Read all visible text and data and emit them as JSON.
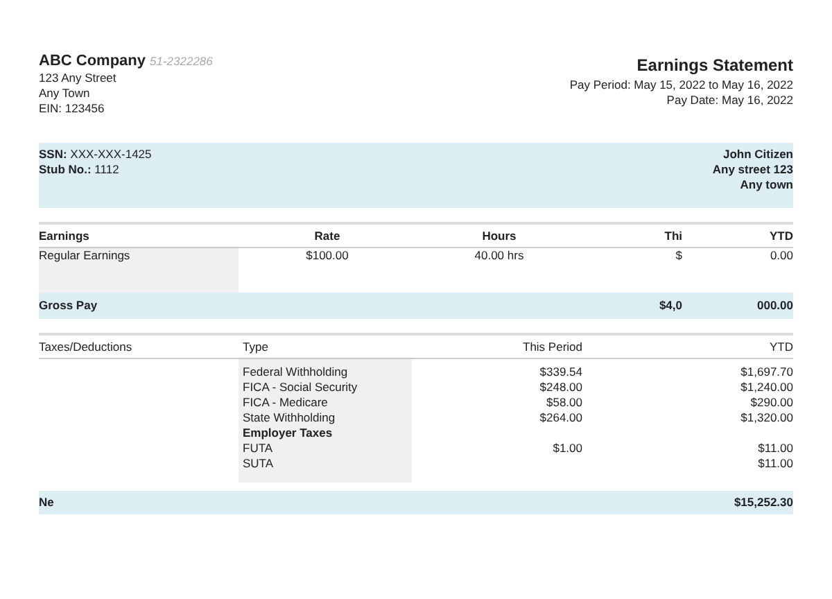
{
  "company": {
    "name": "ABC Company",
    "ein_code": "51-2322286",
    "lines": [
      "123 Any Street",
      "Any Town",
      "EIN: 123456"
    ]
  },
  "statement": {
    "title": "Earnings Statement",
    "pay_period": "Pay Period: May 15, 2022 to May 16, 2022",
    "pay_date": "Pay Date: May 16, 2022"
  },
  "employee": {
    "ssn_label": "SSN:",
    "ssn": "XXX-XXX-1425",
    "stub_label": "Stub No.:",
    "stub": "1112",
    "name": "John Citizen",
    "address": [
      "Any street 123",
      "Any town"
    ]
  },
  "earnings": {
    "columns": [
      "Earnings",
      "Rate",
      "Hours",
      "Thi",
      "YTD"
    ],
    "rows": [
      {
        "cells": [
          "Regular Earnings",
          "$100.00",
          "40.00 hrs",
          "$",
          "0.00"
        ]
      }
    ],
    "total": {
      "label": "Gross Pay",
      "this_period": "$4,0",
      "ytd": "000.00"
    }
  },
  "deductions": {
    "columns": [
      "Taxes/Deductions",
      "Type",
      "This Period",
      "YTD"
    ],
    "rows": [
      {
        "kind": "item",
        "type": "Federal Withholding",
        "this_period": "$339.54",
        "ytd": "$1,697.70"
      },
      {
        "kind": "item",
        "type": "FICA - Social Security",
        "this_period": "$248.00",
        "ytd": "$1,240.00"
      },
      {
        "kind": "item",
        "type": "FICA - Medicare",
        "this_period": "$58.00",
        "ytd": "$290.00"
      },
      {
        "kind": "item",
        "type": "State Withholding",
        "this_period": "$264.00",
        "ytd": "$1,320.00"
      },
      {
        "kind": "heading",
        "type": "Employer Taxes"
      },
      {
        "kind": "item",
        "type": "FUTA",
        "this_period": "$1.00",
        "ytd": "$11.00"
      },
      {
        "kind": "item",
        "type": "SUTA",
        "ytd": "$11.00"
      }
    ]
  },
  "net_pay": {
    "label": "Ne",
    "amount": "$15,252.30"
  }
}
